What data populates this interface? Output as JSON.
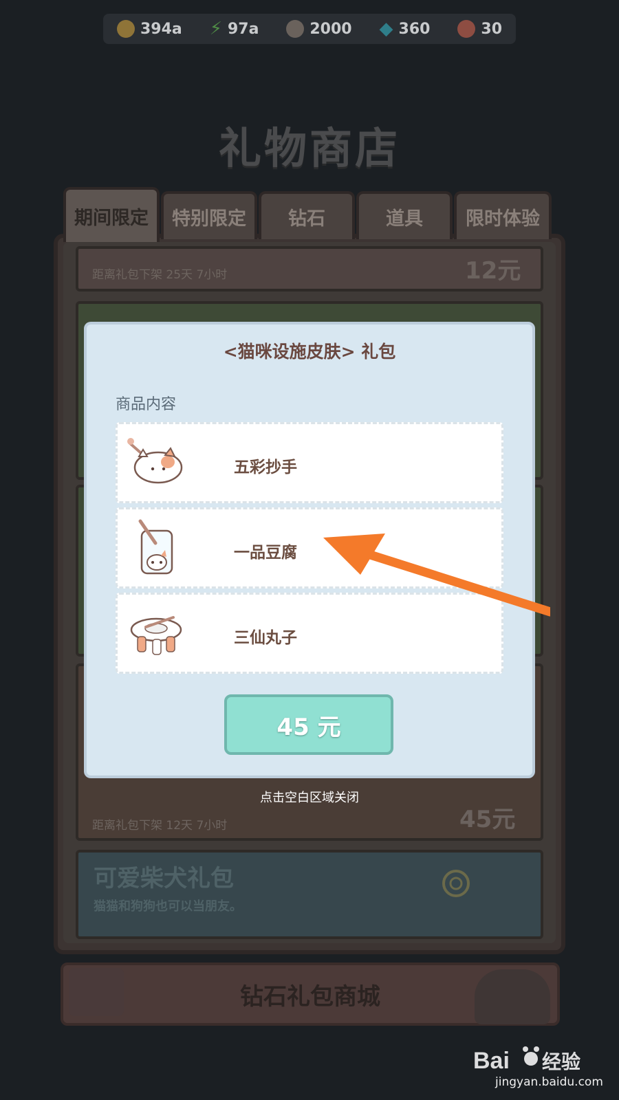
{
  "currency": [
    {
      "icon": "coin-icon",
      "value": "394a",
      "color": "#d9a440"
    },
    {
      "icon": "energy-icon",
      "value": "97a",
      "color": "#5fbf5a"
    },
    {
      "icon": "ticket-icon",
      "value": "2000",
      "color": "#9a8f86"
    },
    {
      "icon": "diamond-icon",
      "value": "360",
      "color": "#3bb6c9"
    },
    {
      "icon": "fish-icon",
      "value": "30",
      "color": "#e06a55"
    }
  ],
  "title": "礼物商店",
  "tabs": [
    "期间限定",
    "特别限定",
    "钻石",
    "道具",
    "限时体验"
  ],
  "background_packs": {
    "top_timer": "距离礼包下架 25天 7小时",
    "top_price": "12元",
    "orange_timer": "距离礼包下架 12天 7小时",
    "orange_price": "45元",
    "blue_title": "可爱柴犬礼包",
    "blue_subtitle": "猫猫和狗狗也可以当朋友。"
  },
  "modal": {
    "title": "<猫咪设施皮肤> 礼包",
    "section_label": "商品内容",
    "items": [
      {
        "name": "五彩抄手",
        "icon": "bowl-cat-icon"
      },
      {
        "name": "一品豆腐",
        "icon": "cup-cat-icon"
      },
      {
        "name": "三仙丸子",
        "icon": "plate-cat-icon"
      }
    ],
    "price_button": "45 元",
    "close_hint": "点击空白区域关闭"
  },
  "diamond_mall_button": "钻石礼包商城",
  "colors": {
    "modal_bg": "#d8e7f1",
    "price_button": "#90e0d2",
    "arrow": "#f47a2a",
    "item_text": "#6b4d40"
  },
  "watermark": {
    "logo": "Baidu经验",
    "url": "jingyan.baidu.com"
  }
}
